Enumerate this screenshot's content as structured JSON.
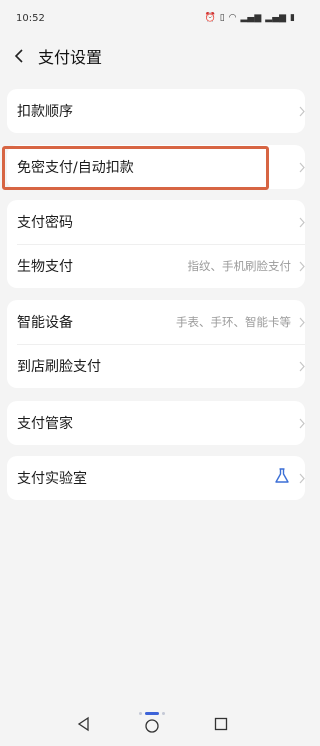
{
  "status": {
    "time": "10:52",
    "icons": [
      "alarm-icon",
      "vibrate-icon",
      "wifi-icon",
      "signal-icon",
      "signal-icon",
      "battery-icon"
    ]
  },
  "nav": {
    "title": "支付设置"
  },
  "groups": [
    {
      "rows": [
        {
          "label": "扣款顺序",
          "hint": ""
        }
      ]
    },
    {
      "rows": [
        {
          "label": "免密支付/自动扣款",
          "hint": ""
        }
      ]
    },
    {
      "rows": [
        {
          "label": "支付密码",
          "hint": ""
        },
        {
          "label": "生物支付",
          "hint": "指纹、手机刷脸支付"
        }
      ]
    },
    {
      "rows": [
        {
          "label": "智能设备",
          "hint": "手表、手环、智能卡等"
        },
        {
          "label": "到店刷脸支付",
          "hint": ""
        }
      ]
    },
    {
      "rows": [
        {
          "label": "支付管家",
          "hint": ""
        }
      ]
    },
    {
      "rows": [
        {
          "label": "支付实验室",
          "hint": ""
        }
      ]
    }
  ],
  "colors": {
    "highlight": "#d76543",
    "flask": "#3b6fd6",
    "accent": "#3d63d8"
  }
}
